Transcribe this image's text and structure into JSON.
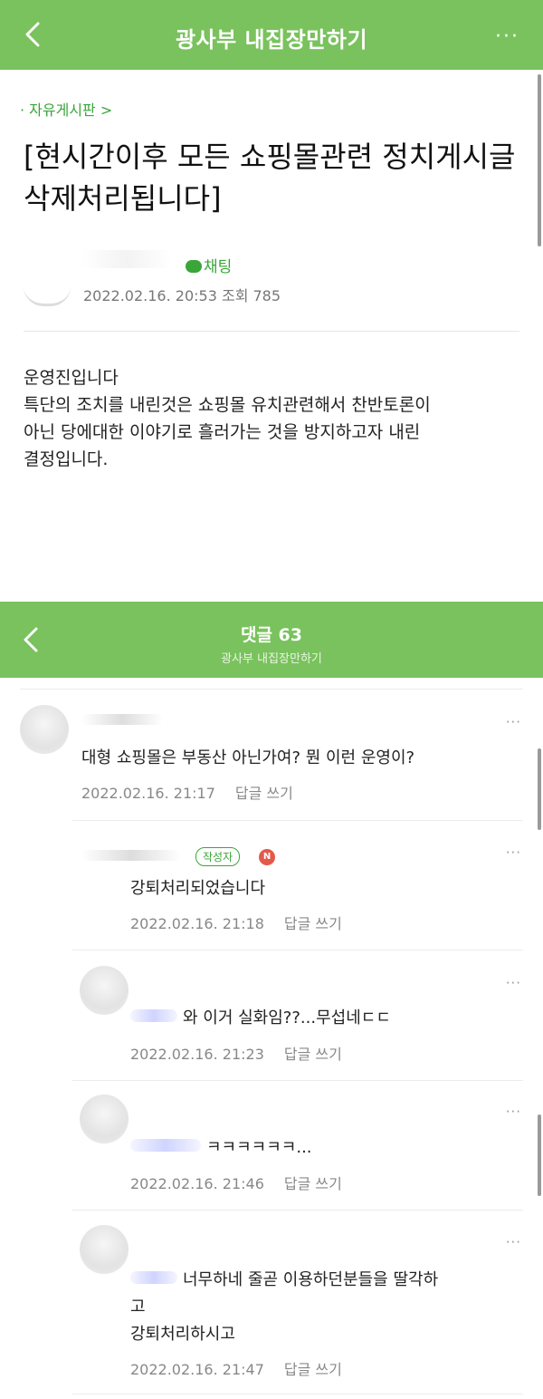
{
  "header": {
    "title": "광사부  내집장만하기"
  },
  "post": {
    "board": "· 자유게시판 >",
    "title": "[현시간이후 모든 쇼핑몰관련 정치게시글 삭제처리됩니다]",
    "chat_label": "채팅",
    "meta": "2022.02.16. 20:53 조회 785",
    "body": [
      "운영진입니다",
      "특단의 조치를 내린것은 쇼핑몰 유치관련해서 찬반토론이",
      "아닌 당에대한 이야기로 흘러가는 것을 방지하고자 내린",
      "결정입니다."
    ]
  },
  "comments_header": {
    "title": "댓글 63",
    "subtitle": "광사부  내집장만하기"
  },
  "comments": [
    {
      "text": "대형 쇼핑몰은 부동산 아닌가여? 뭔 이런 운영이?",
      "time": "2022.02.16. 21:17",
      "reply": "답글 쓰기"
    },
    {
      "badge": "작성자",
      "n_badge": "N",
      "text": "강퇴처리되었습니다",
      "time": "2022.02.16. 21:18",
      "reply": "답글 쓰기"
    },
    {
      "text": "와 이거 실화임??...무섭네ㄷㄷ",
      "time": "2022.02.16. 21:23",
      "reply": "답글 쓰기"
    },
    {
      "text": "ㅋㅋㅋㅋㅋㅋ...",
      "time": "2022.02.16. 21:46",
      "reply": "답글 쓰기"
    },
    {
      "text_lines": [
        "너무하네 줄곧 이용하던분들을 딸각하",
        "고",
        "강퇴처리하시고"
      ],
      "time": "2022.02.16. 21:47",
      "reply": "답글 쓰기"
    }
  ],
  "more_label": "···",
  "colors": {
    "accent": "#79c25d",
    "link_green": "#3aa63a"
  }
}
